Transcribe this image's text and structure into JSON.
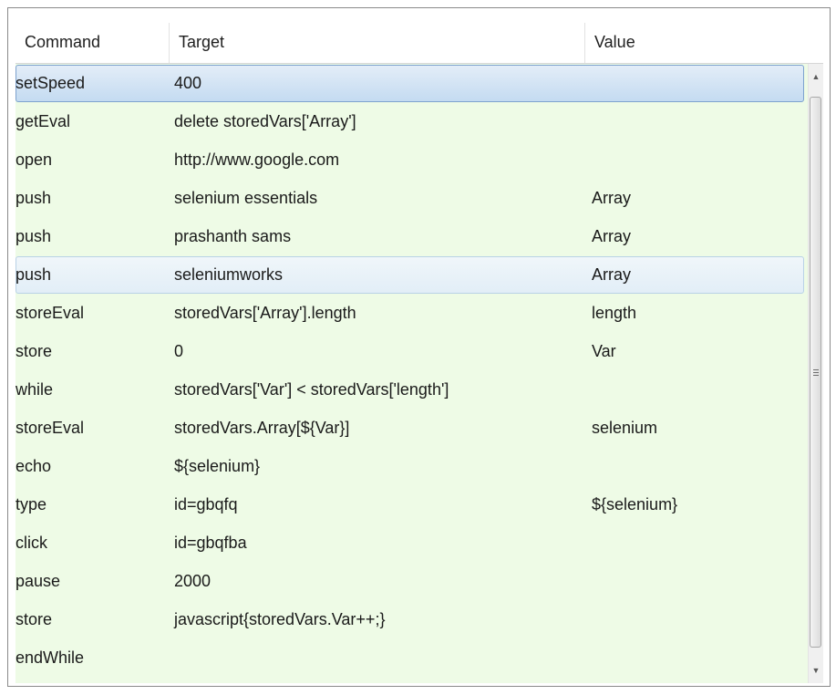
{
  "table": {
    "columns": [
      "Command",
      "Target",
      "Value"
    ],
    "selected_row": 0,
    "hover_row": 5,
    "rows": [
      {
        "command": "setSpeed",
        "target": "400",
        "value": ""
      },
      {
        "command": "getEval",
        "target": "delete storedVars['Array']",
        "value": ""
      },
      {
        "command": "open",
        "target": "http://www.google.com",
        "value": ""
      },
      {
        "command": "push",
        "target": "selenium essentials",
        "value": "Array"
      },
      {
        "command": "push",
        "target": "prashanth sams",
        "value": "Array"
      },
      {
        "command": "push",
        "target": "seleniumworks",
        "value": "Array"
      },
      {
        "command": "storeEval",
        "target": "storedVars['Array'].length",
        "value": "length"
      },
      {
        "command": "store",
        "target": "0",
        "value": "Var"
      },
      {
        "command": "while",
        "target": "storedVars['Var'] < storedVars['length']",
        "value": ""
      },
      {
        "command": "storeEval",
        "target": "storedVars.Array[${Var}]",
        "value": "selenium"
      },
      {
        "command": "echo",
        "target": "${selenium}",
        "value": ""
      },
      {
        "command": "type",
        "target": "id=gbqfq",
        "value": "${selenium}"
      },
      {
        "command": "click",
        "target": "id=gbqfba",
        "value": ""
      },
      {
        "command": "pause",
        "target": "2000",
        "value": ""
      },
      {
        "command": "store",
        "target": "javascript{storedVars.Var++;}",
        "value": ""
      },
      {
        "command": "endWhile",
        "target": "",
        "value": ""
      }
    ]
  },
  "scrollbar": {
    "up_icon": "triangle-up-icon",
    "down_icon": "triangle-down-icon",
    "grip_icon": "grip-lines-icon"
  },
  "colors": {
    "row_background": "#eefbe6",
    "selection": "#c4dbf1",
    "selection_border": "#7da2ce"
  }
}
